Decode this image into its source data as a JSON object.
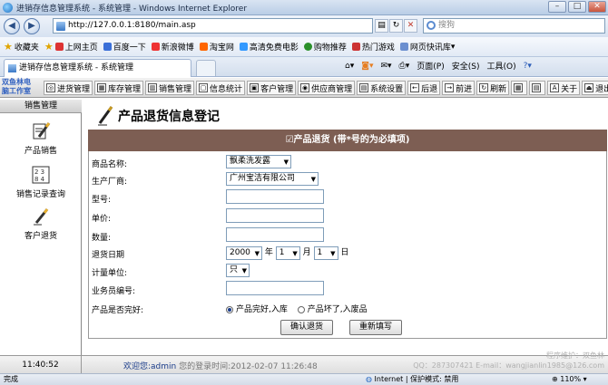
{
  "window": {
    "title": "进销存信息管理系统 - 系统管理 - Windows Internet Explorer"
  },
  "address": {
    "url": "http://127.0.0.1:8180/main.asp",
    "search_placeholder": "搜狗"
  },
  "favorites": {
    "label": "收藏夹",
    "items": [
      "上网主页",
      "百度一下",
      "新浪微博",
      "淘宝网",
      "高清免费电影",
      "购物推荐",
      "热门游戏",
      "网页快讯库"
    ]
  },
  "tab": {
    "title": "进销存信息管理系统 - 系统管理"
  },
  "commands": {
    "page": "页面(P)",
    "safety": "安全(S)",
    "tools": "工具(O)"
  },
  "app": {
    "logo_line1": "双鱼林电",
    "logo_line2": "脑工作室",
    "menu": [
      "进货管理",
      "库存管理",
      "销售管理",
      "信息统计",
      "客户管理",
      "供应商管理",
      "系统设置",
      "后退",
      "前进",
      "刷新",
      "关于",
      "退出"
    ]
  },
  "sidebar": {
    "title": "销售管理",
    "items": [
      "产品销售",
      "销售记录查询",
      "客户退货"
    ]
  },
  "page": {
    "title": "产品退货信息登记",
    "form_header": "☑产品退货 (带*号的为必填项)"
  },
  "form": {
    "product_label": "商品名称:",
    "product_value": "飘柔洗发露",
    "vendor_label": "生产厂商:",
    "vendor_value": "广州宝洁有限公司",
    "model_label": "型号:",
    "price_label": "单价:",
    "qty_label": "数量:",
    "date_label": "退货日期",
    "year_value": "2000",
    "year_unit": "年",
    "month_value": "1",
    "month_unit": "月",
    "day_value": "1",
    "day_unit": "日",
    "unit_label": "计量单位:",
    "unit_value": "只",
    "salesman_label": "业务员编号:",
    "intact_label": "产品是否完好:",
    "radio_good": "产品完好,入库",
    "radio_bad": "产品坏了,入废品",
    "confirm_button": "确认退货",
    "reset_button": "重新填写"
  },
  "bottom": {
    "clock": "11:40:52",
    "welcome_prefix": "欢迎您:",
    "user": "admin",
    "last_login": "您的登录时间:2012-02-07 11:26:48",
    "credits_line1": "程序维护：双鱼林",
    "credits_line2": "QQ：287307421 E-mail：wangjianlin1985@126.com"
  },
  "status": {
    "left": "完成",
    "zone": "Internet | 保护模式: 禁用",
    "zoom": "110%"
  }
}
